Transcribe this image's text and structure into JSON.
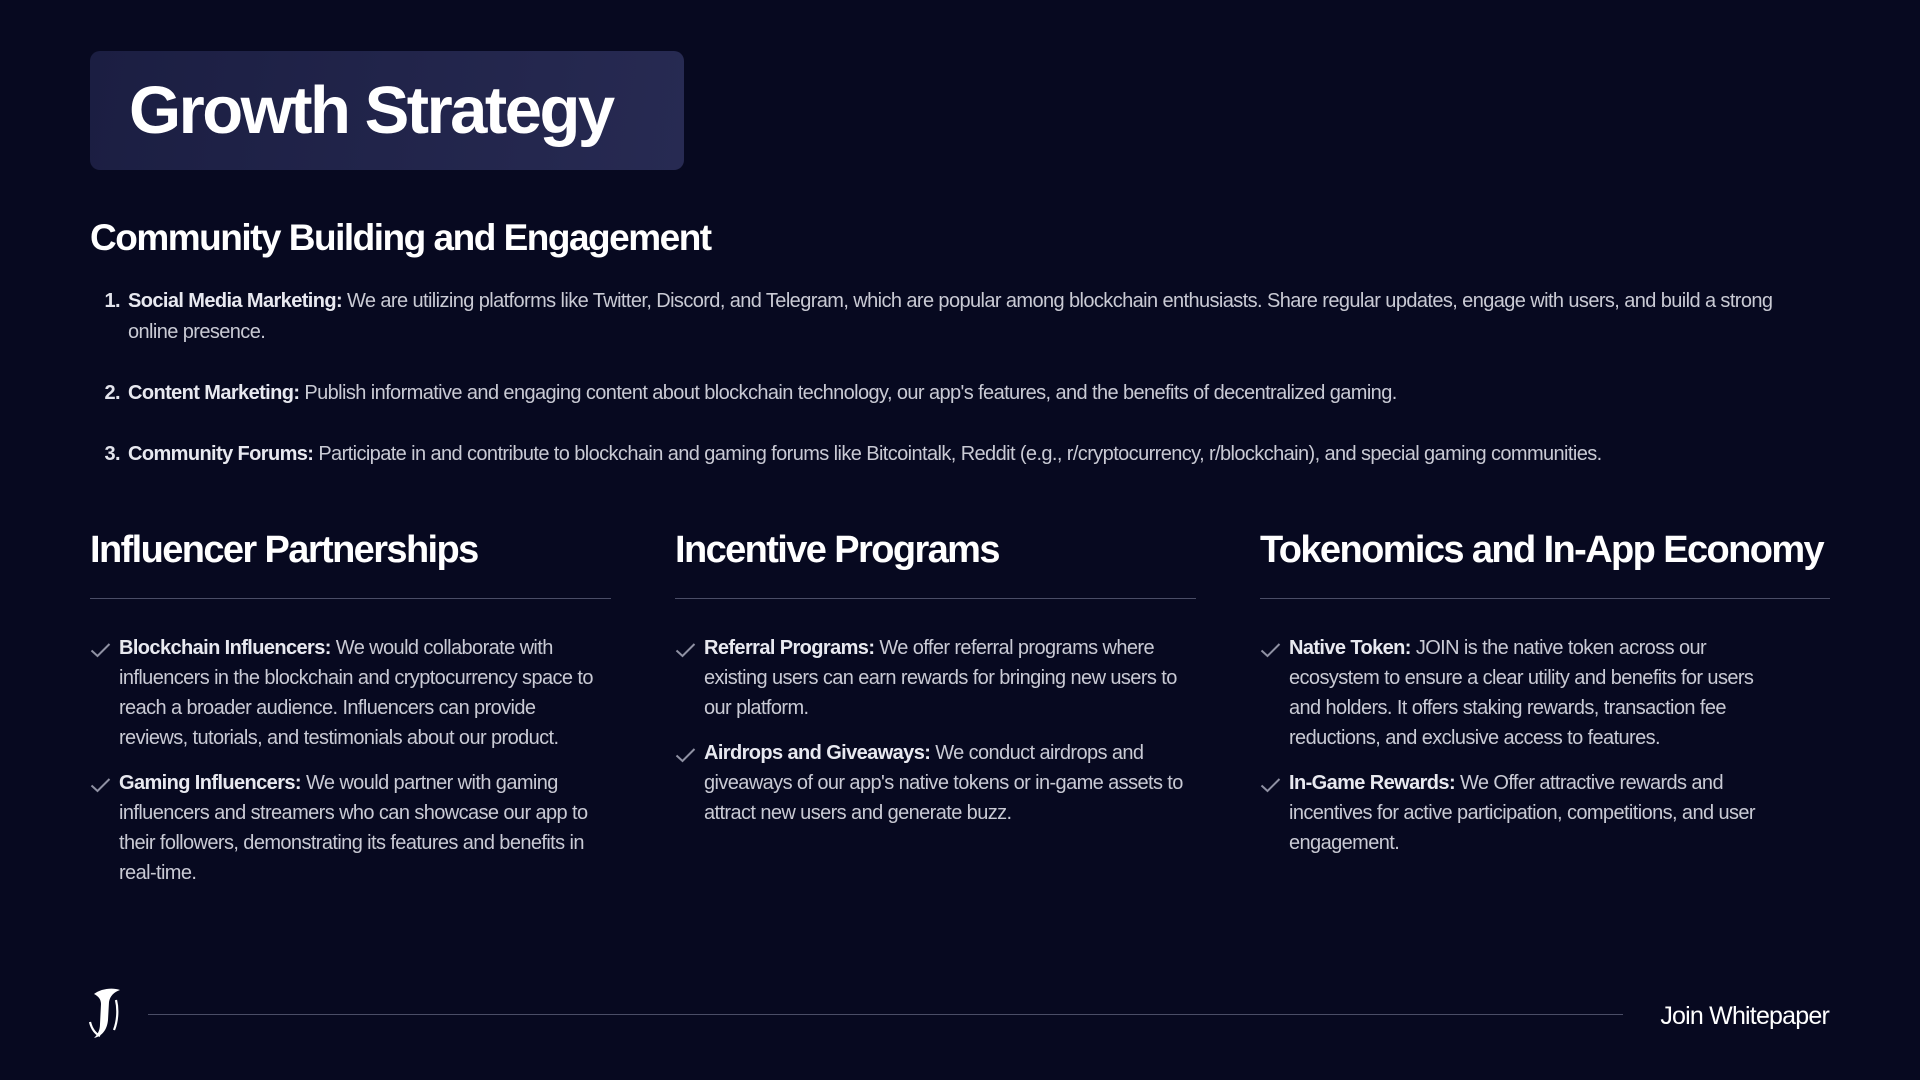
{
  "title": "Growth Strategy",
  "community": {
    "heading": "Community Building and Engagement",
    "items": [
      {
        "number": "1.",
        "label": "Social Media Marketing:",
        "text": " We are utilizing platforms like Twitter, Discord, and Telegram, which are popular among blockchain enthusiasts. Share regular updates, engage with users, and build a strong online presence."
      },
      {
        "number": "2.",
        "label": "Content Marketing:",
        "text": " Publish informative and engaging content about blockchain technology, our app's features, and the benefits of decentralized gaming."
      },
      {
        "number": "3.",
        "label": "Community Forums:",
        "text": " Participate in and contribute to blockchain and gaming forums like Bitcointalk, Reddit (e.g., r/cryptocurrency, r/blockchain), and special gaming communities."
      }
    ]
  },
  "columns": [
    {
      "heading": "Influencer Partnerships",
      "items": [
        {
          "label": "Blockchain Influencers:",
          "text": " We would collaborate with influencers in the blockchain and cryptocurrency space to reach a broader audience. Influencers can provide reviews, tutorials, and testimonials about our product."
        },
        {
          "label": "Gaming Influencers:",
          "text": " We would partner with gaming influencers and streamers who can showcase our app to their followers, demonstrating its features and benefits in real-time."
        }
      ]
    },
    {
      "heading": "Incentive Programs",
      "items": [
        {
          "label": "Referral Programs:",
          "text": " We offer referral programs where existing users can earn rewards for bringing new users to our platform."
        },
        {
          "label": "Airdrops and Giveaways:",
          "text": " We conduct airdrops and giveaways of our app's native tokens or in-game assets to attract new users and generate buzz."
        }
      ]
    },
    {
      "heading": "Tokenomics and In-App Economy",
      "items": [
        {
          "label": "Native Token:",
          "text": " JOIN is the native token across our ecosystem to ensure a clear utility and benefits for users and holders. It offers staking rewards, transaction fee reductions, and exclusive access to features."
        },
        {
          "label": "In-Game Rewards:",
          "text": " We Offer attractive rewards and incentives for active participation, competitions, and user engagement."
        }
      ]
    }
  ],
  "footer": {
    "logo_icon": "join-logo-icon",
    "label": "Join Whitepaper"
  },
  "colors": {
    "background": "#070920",
    "title_box": "#22254a",
    "body_text": "#c9cad4",
    "rule": "#4a4d66",
    "check": "#8f91a3"
  }
}
